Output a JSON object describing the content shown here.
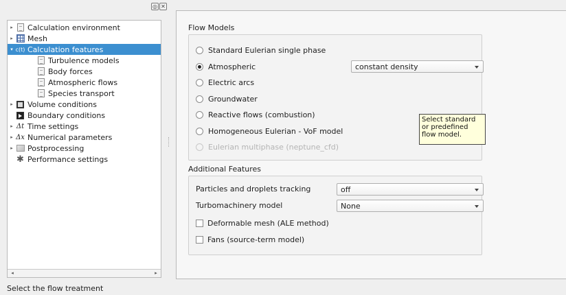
{
  "tree": {
    "items": [
      {
        "label": "Calculation environment",
        "icon": "document-icon",
        "arrow": "▸"
      },
      {
        "label": "Mesh",
        "icon": "mesh-icon",
        "arrow": "▸"
      },
      {
        "label": "Calculation features",
        "icon": "calculation-features-icon",
        "arrow": "▾"
      },
      {
        "label": "Turbulence models",
        "icon": "document-icon"
      },
      {
        "label": "Body forces",
        "icon": "document-icon"
      },
      {
        "label": "Atmospheric flows",
        "icon": "document-icon"
      },
      {
        "label": "Species transport",
        "icon": "document-icon"
      },
      {
        "label": "Volume conditions",
        "icon": "volume-icon",
        "arrow": "▸"
      },
      {
        "label": "Boundary conditions",
        "icon": "boundary-icon"
      },
      {
        "label": "Time settings",
        "icon": "delta-t-icon",
        "glyph": "Δt",
        "arrow": "▸"
      },
      {
        "label": "Numerical parameters",
        "icon": "delta-x-icon",
        "glyph": "Δx",
        "arrow": "▸"
      },
      {
        "label": "Postprocessing",
        "icon": "postprocessing-icon",
        "arrow": "▸"
      },
      {
        "label": "Performance settings",
        "icon": "gear-icon",
        "glyph": "✱"
      }
    ],
    "selected_glyph": "c(t)",
    "scroll_left": "◂",
    "scroll_right": "▸"
  },
  "dock_buttons": {
    "float": "◎",
    "close": "✕"
  },
  "flow_models": {
    "title": "Flow Models",
    "options": [
      {
        "label": "Standard Eulerian single phase",
        "checked": false,
        "enabled": true
      },
      {
        "label": "Atmospheric",
        "checked": true,
        "enabled": true
      },
      {
        "label": "Electric arcs",
        "checked": false,
        "enabled": true
      },
      {
        "label": "Groundwater",
        "checked": false,
        "enabled": true
      },
      {
        "label": "Reactive flows (combustion)",
        "checked": false,
        "enabled": true
      },
      {
        "label": "Homogeneous Eulerian - VoF model",
        "checked": false,
        "enabled": true
      },
      {
        "label": "Eulerian multiphase (neptune_cfd)",
        "checked": false,
        "enabled": false
      }
    ],
    "atmospheric_combo": "constant density"
  },
  "tooltip": {
    "line1": "Select standard",
    "line2": "or predefined",
    "line3": "flow model."
  },
  "additional_features": {
    "title": "Additional Features",
    "particles_label": "Particles and droplets tracking",
    "particles_value": "off",
    "turbo_label": "Turbomachinery model",
    "turbo_value": "None",
    "deformable_label": "Deformable mesh (ALE method)",
    "fans_label": "Fans (source-term model)"
  },
  "status_bar": {
    "text": "Select the flow treatment"
  }
}
